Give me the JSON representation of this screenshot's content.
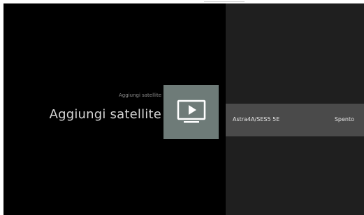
{
  "header": {
    "subtitle": "Aggiungi satellite",
    "title": "Aggiungi satellite"
  },
  "icon": {
    "name": "play-tv-icon"
  },
  "list": {
    "rows": [
      {
        "label": "Astra4A/SES5 5E",
        "value": "Spento"
      }
    ]
  },
  "colors": {
    "background": "#000000",
    "panel": "#1f1f1f",
    "selected_row": "#4a4a4a",
    "icon_tile": "#6e7b78",
    "text_primary": "#d6d6d6",
    "text_secondary": "#8c8c8c"
  }
}
